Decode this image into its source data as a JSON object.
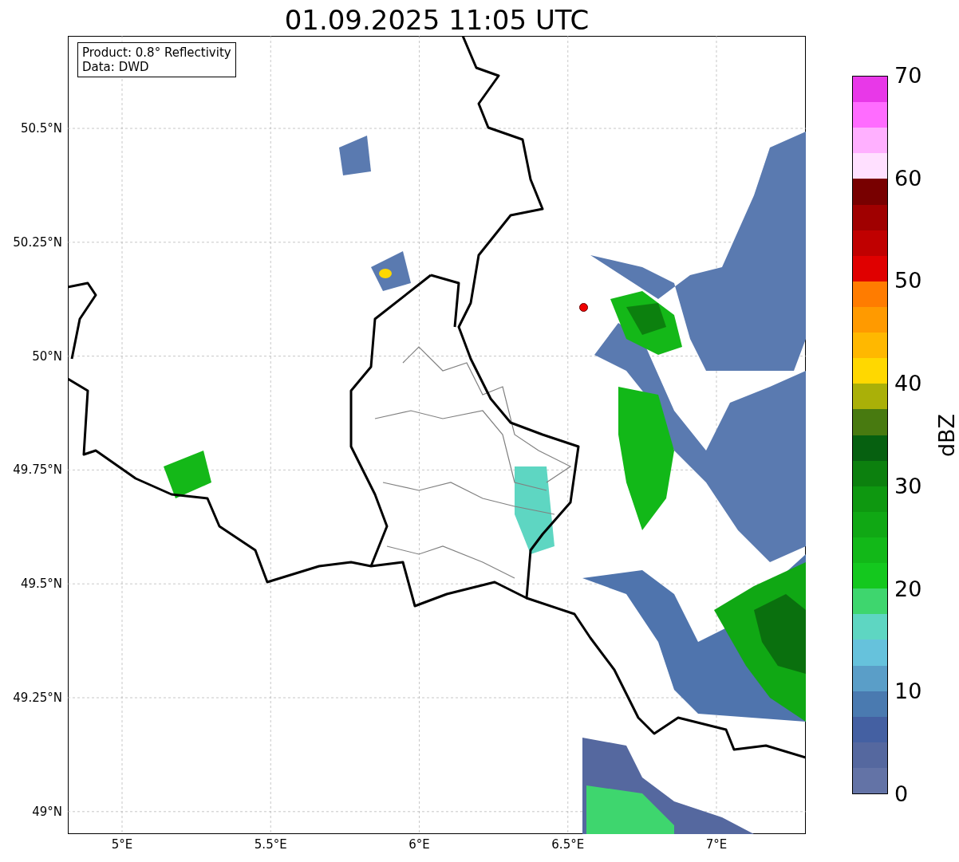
{
  "title": "01.09.2025 11:05 UTC",
  "info_box": [
    "Product: 0.8° Reflectivity",
    "Data: DWD"
  ],
  "map": {
    "xticks": [
      "5°E",
      "5.5°E",
      "6°E",
      "6.5°E",
      "7°E"
    ],
    "yticks": [
      "50.5°N",
      "50.25°N",
      "50°N",
      "49.75°N",
      "49.5°N",
      "49.25°N",
      "49°N"
    ]
  },
  "colorbar": {
    "label": "dBZ",
    "ticks": [
      "70",
      "60",
      "50",
      "40",
      "30",
      "20",
      "10",
      "0"
    ],
    "bands": [
      {
        "color": "#e838e8"
      },
      {
        "color": "#ff6cff"
      },
      {
        "color": "#ffb0ff"
      },
      {
        "color": "#ffe0ff"
      },
      {
        "color": "#780000"
      },
      {
        "color": "#a00000"
      },
      {
        "color": "#c00000"
      },
      {
        "color": "#e00000"
      },
      {
        "color": "#ff7c00"
      },
      {
        "color": "#ff9a00"
      },
      {
        "color": "#ffb800"
      },
      {
        "color": "#ffd800"
      },
      {
        "color": "#aab008"
      },
      {
        "color": "#487a10"
      },
      {
        "color": "#066010"
      },
      {
        "color": "#0c800e"
      },
      {
        "color": "#0e9810"
      },
      {
        "color": "#10a814"
      },
      {
        "color": "#12b818"
      },
      {
        "color": "#14c81e"
      },
      {
        "color": "#3ed66e"
      },
      {
        "color": "#5ed6c2"
      },
      {
        "color": "#66c2dc"
      },
      {
        "color": "#5a9ec8"
      },
      {
        "color": "#4a7ab0"
      },
      {
        "color": "#4460a2"
      },
      {
        "color": "#55689f"
      },
      {
        "color": "#6373a6"
      }
    ]
  }
}
